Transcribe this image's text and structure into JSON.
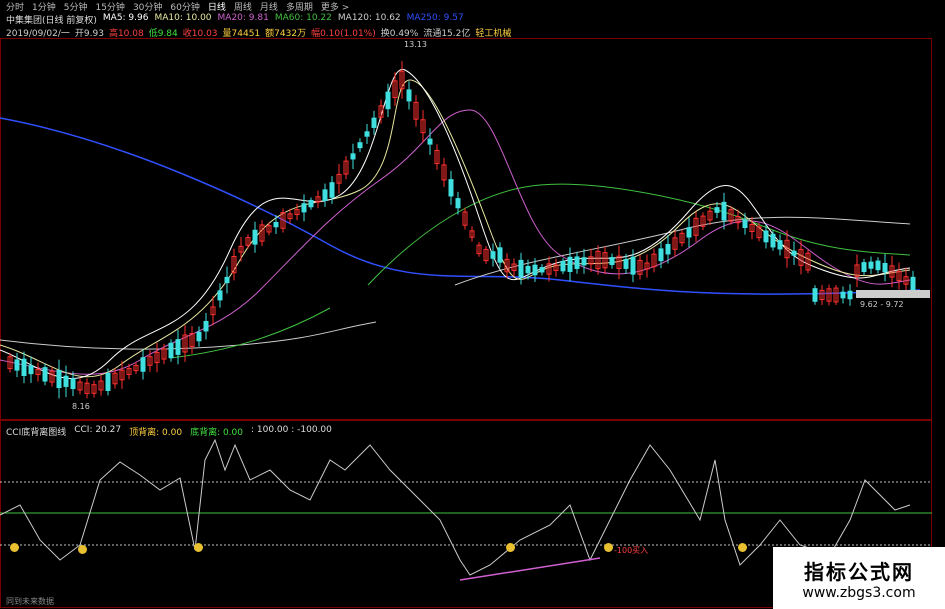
{
  "toolbar": {
    "timeframes": [
      "分时",
      "1分钟",
      "5分钟",
      "15分钟",
      "30分钟",
      "60分钟",
      "日线",
      "周线",
      "月线",
      "多周期",
      "更多 >"
    ],
    "active": "日线"
  },
  "ma_header": {
    "stock": "中集集团(日线 前复权)",
    "items": [
      {
        "label": "MA5: 9.96",
        "color": "#ffffff"
      },
      {
        "label": "MA10: 10.00",
        "color": "#e8e8a0"
      },
      {
        "label": "MA20: 9.81",
        "color": "#d060d0"
      },
      {
        "label": "MA60: 10.22",
        "color": "#40c040"
      },
      {
        "label": "MA120: 10.62",
        "color": "#cccccc"
      },
      {
        "label": "MA250: 9.57",
        "color": "#3050ff"
      }
    ]
  },
  "info": {
    "date": "2019/09/02/一",
    "open": "开9.93",
    "high": "高10.08",
    "low": "低9.84",
    "close": "收10.03",
    "volume": "量74451",
    "amount": "额7432万",
    "change": "幅0.10(1.01%)",
    "turnover": "换0.49%",
    "float": "流通15.2亿",
    "industry": "轻工机械"
  },
  "annotations": {
    "high": "13.13",
    "low": "8.16",
    "range": "9.62 - 9.72",
    "buy": "-100买入"
  },
  "indicator": {
    "name": "CCI底背离图线",
    "cci": "CCI: 20.27",
    "top": "顶背离: 0.00",
    "bottom": "底背离: 0.00",
    "levels": ": 100.00 : -100.00"
  },
  "watermark": {
    "title": "指标公式网",
    "url": "www.zbgs3.com"
  },
  "footer": "同到未来数据",
  "colors": {
    "up": "#ff3030",
    "down": "#40e0e0",
    "frame": "#7a0000"
  }
}
